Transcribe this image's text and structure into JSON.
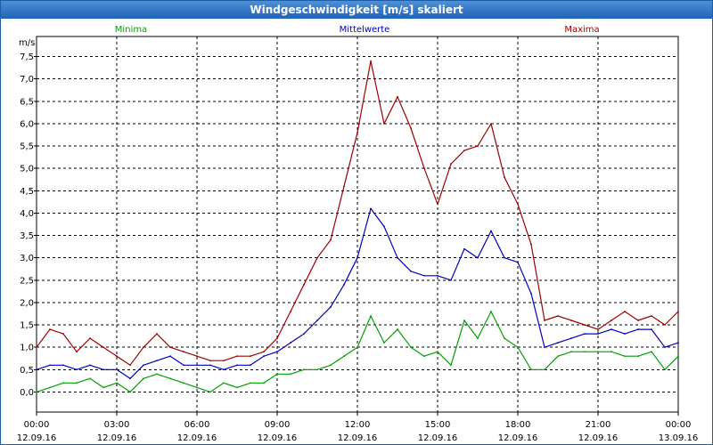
{
  "window": {
    "title": "Windgeschwindigkeit [m/s] skaliert"
  },
  "chart_data": {
    "type": "line",
    "title": "Windgeschwindigkeit [m/s] skaliert",
    "ylabel": "m/s",
    "xlabel": "",
    "ylim": [
      -0.45,
      7.95
    ],
    "xlim": [
      0,
      24
    ],
    "y_ticks": [
      0,
      0.5,
      1,
      1.5,
      2,
      2.5,
      3,
      3.5,
      4,
      4.5,
      5,
      5.5,
      6,
      6.5,
      7,
      7.5
    ],
    "y_tick_labels": [
      "0,0",
      "0,5",
      "1,0",
      "1,5",
      "2,0",
      "2,5",
      "3,0",
      "3,5",
      "4,0",
      "4,5",
      "5,0",
      "5,5",
      "6,0",
      "6,5",
      "7,0",
      "7,5"
    ],
    "x_ticks": [
      0,
      3,
      6,
      9,
      12,
      15,
      18,
      21,
      24
    ],
    "x_tick_labels": [
      {
        "time": "00:00",
        "date": "12.09.16"
      },
      {
        "time": "03:00",
        "date": "12.09.16"
      },
      {
        "time": "06:00",
        "date": "12.09.16"
      },
      {
        "time": "09:00",
        "date": "12.09.16"
      },
      {
        "time": "12:00",
        "date": "12.09.16"
      },
      {
        "time": "15:00",
        "date": "12.09.16"
      },
      {
        "time": "18:00",
        "date": "12.09.16"
      },
      {
        "time": "21:00",
        "date": "12.09.16"
      },
      {
        "time": "00:00",
        "date": "13.09.16"
      }
    ],
    "grid": true,
    "legend_position": "top",
    "x_hours": [
      0,
      0.5,
      1,
      1.5,
      2,
      2.5,
      3,
      3.5,
      4,
      4.5,
      5,
      5.5,
      6,
      6.5,
      7,
      7.5,
      8,
      8.5,
      9,
      9.5,
      10,
      10.5,
      11,
      11.5,
      12,
      12.5,
      13,
      13.5,
      14,
      14.5,
      15,
      15.5,
      16,
      16.5,
      17,
      17.5,
      18,
      18.5,
      19,
      19.5,
      20,
      20.5,
      21,
      21.5,
      22,
      22.5,
      23,
      23.5,
      24
    ],
    "series": [
      {
        "name": "Minima",
        "color": "#00a000",
        "values": [
          0.0,
          0.1,
          0.2,
          0.2,
          0.3,
          0.1,
          0.2,
          0.0,
          0.3,
          0.4,
          0.3,
          0.2,
          0.1,
          0.0,
          0.2,
          0.1,
          0.2,
          0.2,
          0.4,
          0.4,
          0.5,
          0.5,
          0.6,
          0.8,
          1.0,
          1.7,
          1.1,
          1.4,
          1.0,
          0.8,
          0.9,
          0.6,
          1.6,
          1.2,
          1.8,
          1.2,
          1.0,
          0.5,
          0.5,
          0.8,
          0.9,
          0.9,
          0.9,
          0.9,
          0.8,
          0.8,
          0.9,
          0.5,
          0.8
        ]
      },
      {
        "name": "Mittelwerte",
        "color": "#0000c0",
        "values": [
          0.5,
          0.6,
          0.6,
          0.5,
          0.6,
          0.5,
          0.5,
          0.3,
          0.6,
          0.7,
          0.8,
          0.6,
          0.6,
          0.6,
          0.5,
          0.6,
          0.6,
          0.8,
          0.9,
          1.1,
          1.3,
          1.6,
          1.9,
          2.4,
          3.0,
          4.1,
          3.7,
          3.0,
          2.7,
          2.6,
          2.6,
          2.5,
          3.2,
          3.0,
          3.6,
          3.0,
          2.9,
          2.2,
          1.0,
          1.1,
          1.2,
          1.3,
          1.3,
          1.4,
          1.3,
          1.4,
          1.4,
          1.0,
          1.1
        ]
      },
      {
        "name": "Maxima",
        "color": "#a00000",
        "values": [
          1.0,
          1.4,
          1.3,
          0.9,
          1.2,
          1.0,
          0.8,
          0.6,
          1.0,
          1.3,
          1.0,
          0.9,
          0.8,
          0.7,
          0.7,
          0.8,
          0.8,
          0.9,
          1.2,
          1.8,
          2.4,
          3.0,
          3.4,
          4.6,
          5.8,
          7.4,
          6.0,
          6.6,
          5.9,
          5.0,
          4.2,
          5.1,
          5.4,
          5.5,
          6.0,
          4.8,
          4.2,
          3.3,
          1.6,
          1.7,
          1.6,
          1.5,
          1.4,
          1.6,
          1.8,
          1.6,
          1.7,
          1.5,
          1.8
        ]
      }
    ]
  }
}
